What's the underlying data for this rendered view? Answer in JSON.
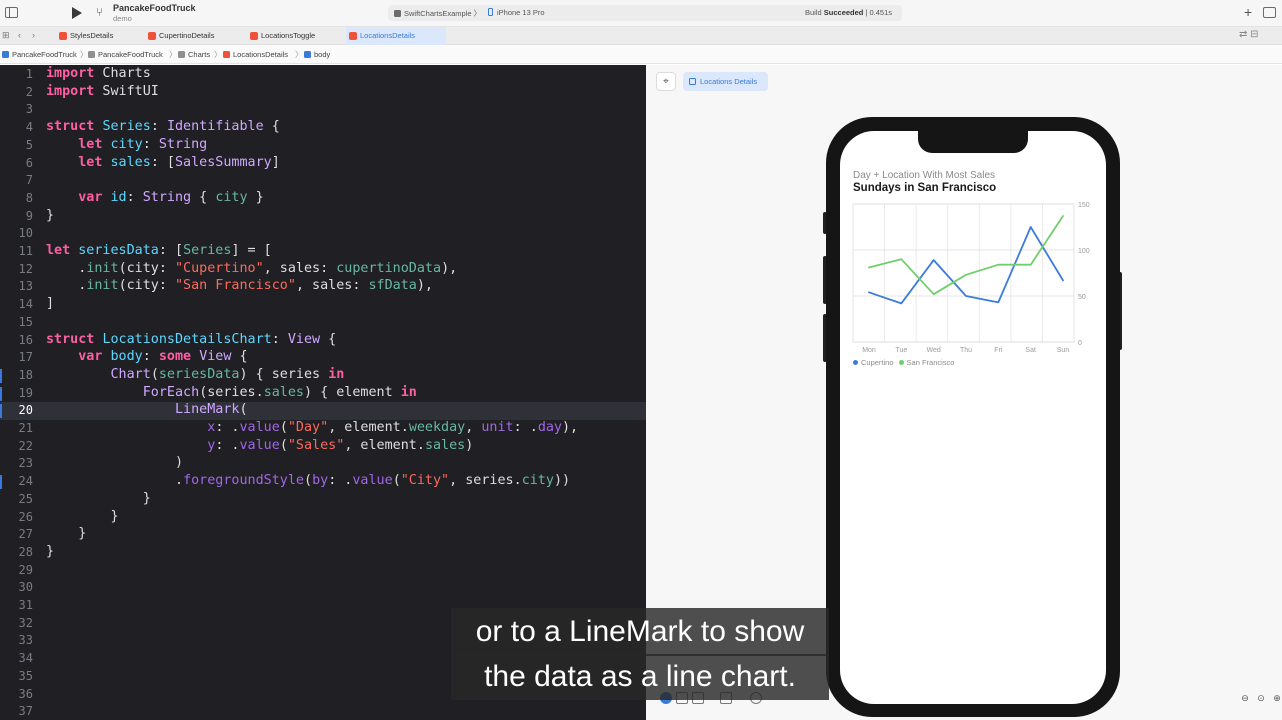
{
  "toolbar": {
    "project_name": "PancakeFoodTruck",
    "project_sub": "demo",
    "scheme": "SwiftChartsExample",
    "destination": "iPhone 13 Pro",
    "build_status_prefix": "Build ",
    "build_status_bold": "Succeeded",
    "build_time": " | 0.451s",
    "sep": "〉"
  },
  "tabs": [
    {
      "label": "StylesDetails"
    },
    {
      "label": "CupertinoDetails"
    },
    {
      "label": "LocationsToggle"
    },
    {
      "label": "LocationsDetails"
    }
  ],
  "breadcrumbs": [
    "PancakeFoodTruck",
    "PancakeFoodTruck",
    "Charts",
    "LocationsDetails",
    "body"
  ],
  "editor": {
    "current_line": 20,
    "lines": [
      {
        "n": "1",
        "html": "<span class='kw'>import</span> Charts"
      },
      {
        "n": "2",
        "html": "<span class='kw'>import</span> SwiftUI"
      },
      {
        "n": "3",
        "html": ""
      },
      {
        "n": "4",
        "html": "<span class='kw'>struct</span> <span class='ty2'>Series</span>: <span class='ty'>Identifiable</span> {"
      },
      {
        "n": "5",
        "html": "    <span class='kw'>let</span> <span class='ty2'>city</span>: <span class='ty'>String</span>"
      },
      {
        "n": "6",
        "html": "    <span class='kw'>let</span> <span class='ty2'>sales</span>: [<span class='ty'>SalesSummary</span>]"
      },
      {
        "n": "7",
        "html": ""
      },
      {
        "n": "8",
        "html": "    <span class='kw'>var</span> <span class='ty2'>id</span>: <span class='ty'>String</span> { <span class='fn'>city</span> }"
      },
      {
        "n": "9",
        "html": "}"
      },
      {
        "n": "10",
        "html": ""
      },
      {
        "n": "11",
        "html": "<span class='kw'>let</span> <span class='ty2'>seriesData</span>: [<span class='fn'>Series</span>] = ["
      },
      {
        "n": "12",
        "html": "    .<span class='fn'>init</span>(city: <span class='st'>\"Cupertino\"</span>, sales: <span class='fn'>cupertinoData</span>),"
      },
      {
        "n": "13",
        "html": "    .<span class='fn'>init</span>(city: <span class='st'>\"San Francisco\"</span>, sales: <span class='fn'>sfData</span>),"
      },
      {
        "n": "14",
        "html": "]"
      },
      {
        "n": "15",
        "html": ""
      },
      {
        "n": "16",
        "html": "<span class='kw'>struct</span> <span class='ty2'>LocationsDetailsChart</span>: <span class='ty'>View</span> {"
      },
      {
        "n": "17",
        "html": "    <span class='kw'>var</span> <span class='ty2'>body</span>: <span class='kw'>some</span> <span class='ty'>View</span> {"
      },
      {
        "n": "18",
        "html": "        <span class='ty'>Chart</span>(<span class='fn'>seriesData</span>) { series <span class='kw'>in</span>"
      },
      {
        "n": "19",
        "html": "            <span class='ty'>ForEach</span>(series.<span class='fn'>sales</span>) { element <span class='kw'>in</span>"
      },
      {
        "n": "20",
        "html": "                <span class='ty'>LineMark</span>("
      },
      {
        "n": "21",
        "html": "                    <span class='pr'>x</span>: .<span class='pr'>value</span>(<span class='st'>\"Day\"</span>, element.<span class='fn'>weekday</span>, <span class='pr'>unit</span>: .<span class='pr'>day</span>),"
      },
      {
        "n": "22",
        "html": "                    <span class='pr'>y</span>: .<span class='pr'>value</span>(<span class='st'>\"Sales\"</span>, element.<span class='fn'>sales</span>)"
      },
      {
        "n": "23",
        "html": "                )"
      },
      {
        "n": "24",
        "html": "                .<span class='pr'>foregroundStyle</span>(<span class='pr'>by</span>: .<span class='pr'>value</span>(<span class='st'>\"City\"</span>, series.<span class='fn'>city</span>))"
      },
      {
        "n": "25",
        "html": "            }"
      },
      {
        "n": "26",
        "html": "        }"
      },
      {
        "n": "27",
        "html": "    }"
      },
      {
        "n": "28",
        "html": "}"
      },
      {
        "n": "29",
        "html": ""
      },
      {
        "n": "30",
        "html": ""
      },
      {
        "n": "31",
        "html": ""
      },
      {
        "n": "32",
        "html": ""
      },
      {
        "n": "33",
        "html": ""
      },
      {
        "n": "34",
        "html": ""
      },
      {
        "n": "35",
        "html": ""
      },
      {
        "n": "36",
        "html": ""
      },
      {
        "n": "37",
        "html": ""
      }
    ],
    "changed_lines": [
      18,
      19,
      20,
      24
    ]
  },
  "canvas": {
    "preview_label": "Locations Details"
  },
  "chart_data": {
    "type": "line",
    "subtitle": "Day + Location With Most Sales",
    "title": "Sundays in San Francisco",
    "categories": [
      "Mon",
      "Tue",
      "Wed",
      "Thu",
      "Fri",
      "Sat",
      "Sun"
    ],
    "ylim": [
      0,
      150
    ],
    "yticks": [
      "150",
      "100",
      "50",
      "0"
    ],
    "series": [
      {
        "name": "Cupertino",
        "color": "#3d7bdb",
        "values": [
          54,
          42,
          89,
          50,
          43,
          125,
          67
        ]
      },
      {
        "name": "San Francisco",
        "color": "#6fcf6a",
        "values": [
          81,
          90,
          52,
          73,
          84,
          84,
          137
        ]
      }
    ],
    "legend_position": "bottom-left",
    "grid": true
  },
  "subtitles": {
    "line1": "or to a LineMark to show",
    "line2": "the data as a line chart."
  }
}
